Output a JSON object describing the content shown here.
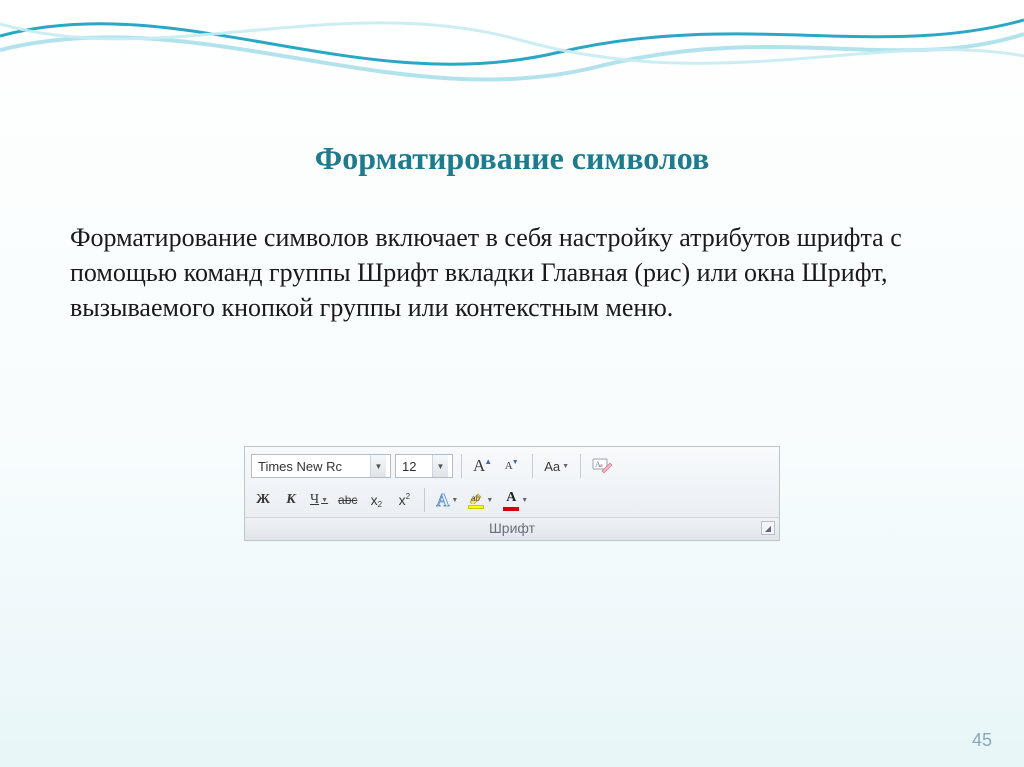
{
  "slide": {
    "title": "Форматирование символов",
    "body": "Форматирование символов включает в себя настройку атрибутов шрифта с помощью команд группы Шрифт вкладки Главная (рис) или окна Шрифт, вызываемого кнопкой группы или контекстным меню.",
    "page_number": "45"
  },
  "ribbon": {
    "font_name": "Times New Rc",
    "font_size": "12",
    "group_label": "Шрифт",
    "buttons": {
      "grow_font": "A",
      "shrink_font": "A",
      "change_case": "Aa",
      "clear_formatting": "",
      "bold": "Ж",
      "italic": "К",
      "underline": "Ч",
      "strike": "abc",
      "subscript_base": "x",
      "subscript_sub": "2",
      "superscript_base": "x",
      "superscript_sup": "2",
      "text_effects": "A",
      "highlight": "ab",
      "font_color": "A"
    }
  }
}
